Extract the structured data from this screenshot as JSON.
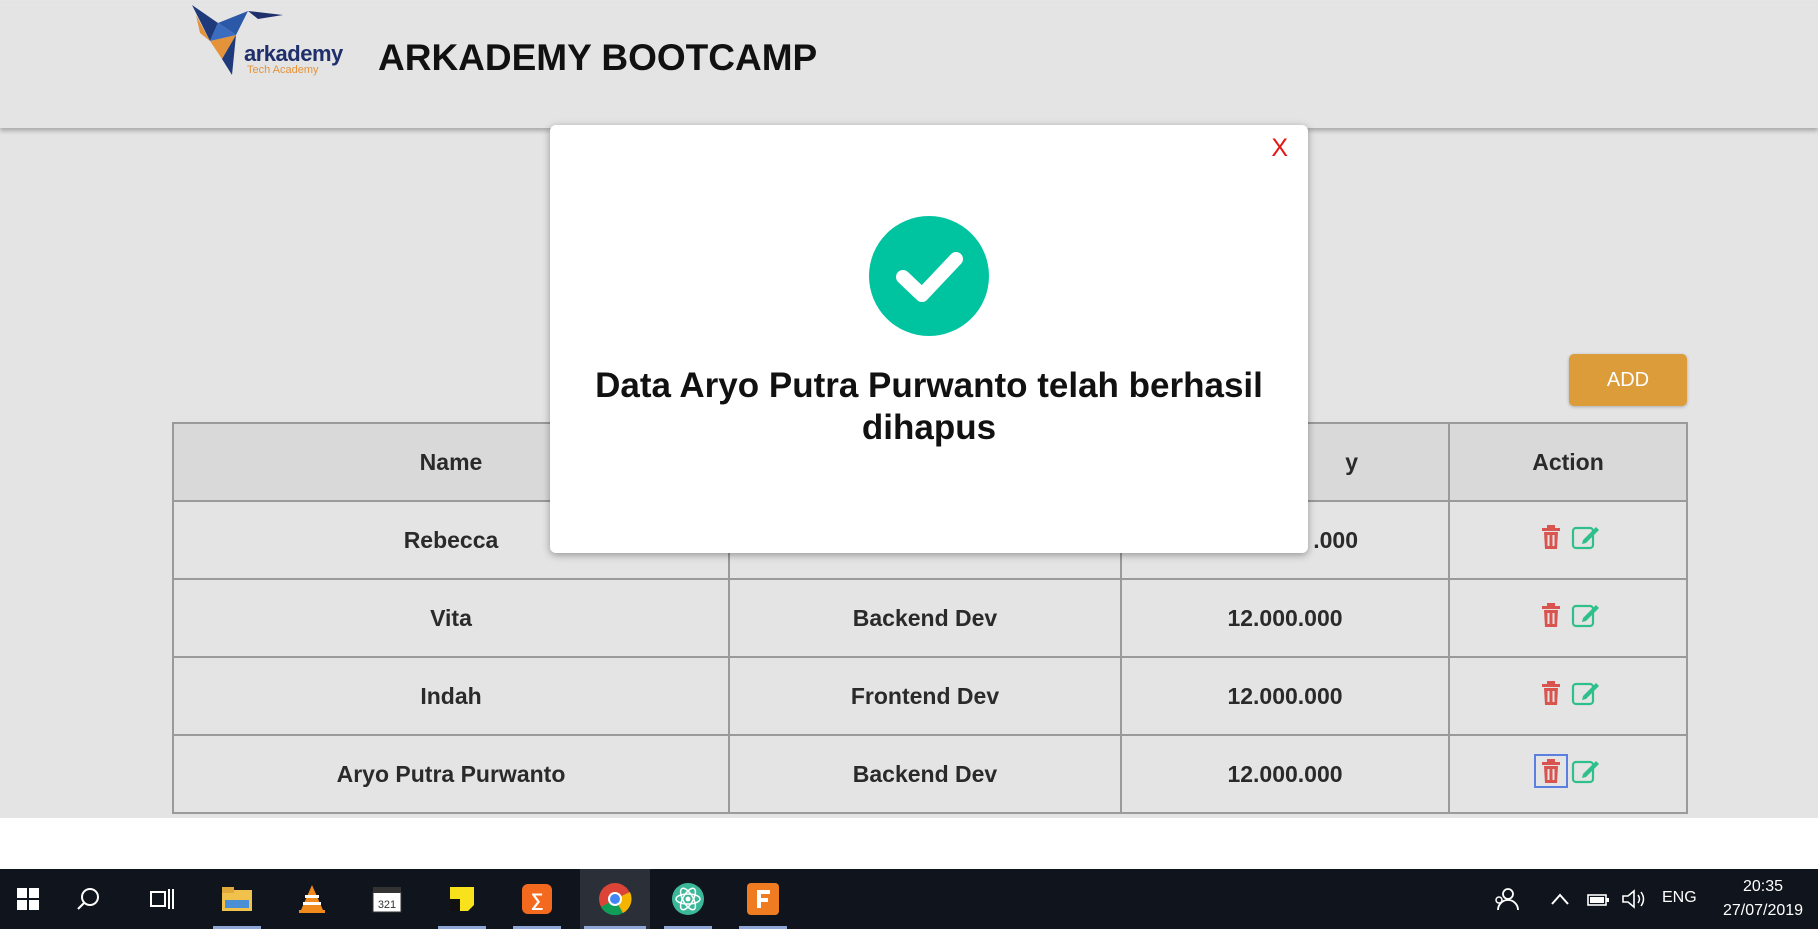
{
  "header": {
    "logo_text": "arkademy",
    "logo_subtext": "Tech Academy",
    "title": "ARKADEMY BOOTCAMP"
  },
  "toolbar": {
    "add_label": "ADD"
  },
  "table": {
    "columns": [
      "Name",
      "",
      "y",
      "Action"
    ],
    "rows": [
      {
        "name": "Rebecca",
        "work": "",
        "salary": ".000"
      },
      {
        "name": "Vita",
        "work": "Backend Dev",
        "salary": "12.000.000"
      },
      {
        "name": "Indah",
        "work": "Frontend Dev",
        "salary": "12.000.000"
      },
      {
        "name": "Aryo Putra Purwanto",
        "work": "Backend Dev",
        "salary": "12.000.000"
      }
    ]
  },
  "modal": {
    "close_label": "X",
    "message": "Data Aryo Putra Purwanto telah berhasil dihapus",
    "icon": "check-circle-icon"
  },
  "taskbar": {
    "language": "ENG",
    "time": "20:35",
    "date": "27/07/2019"
  },
  "colors": {
    "accent_add": "#dd9c3a",
    "success": "#00c4a0",
    "delete": "#d9534f",
    "edit": "#2fbf8a",
    "close": "#e01818"
  }
}
